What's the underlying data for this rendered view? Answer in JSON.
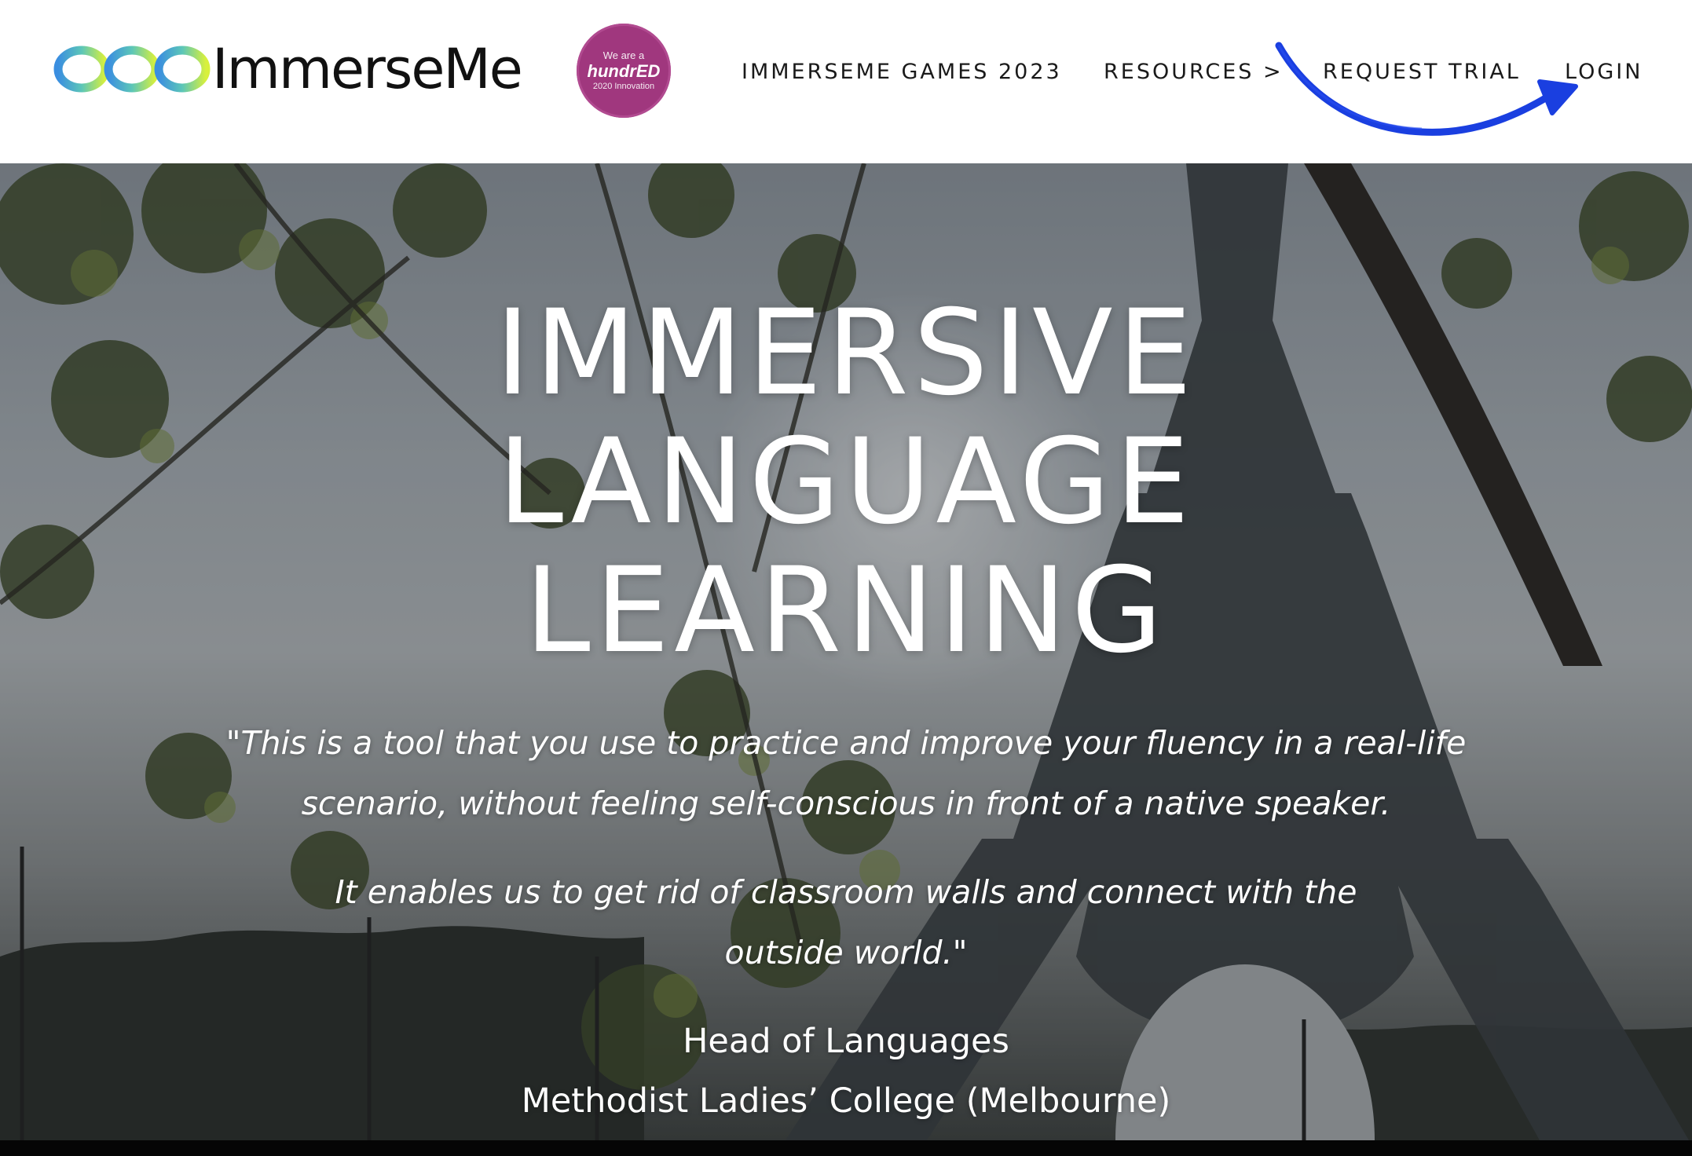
{
  "header": {
    "logo_text": "ImmerseMe",
    "badge": {
      "top": "We are a",
      "brand": "hundrED",
      "sub": "2020 Innovation"
    },
    "nav": [
      {
        "label": "IMMERSEME GAMES 2023"
      },
      {
        "label": "RESOURCES >"
      },
      {
        "label": "REQUEST TRIAL"
      },
      {
        "label": "LOGIN"
      }
    ]
  },
  "hero": {
    "title_lines": [
      "IMMERSIVE",
      "LANGUAGE",
      "LEARNING"
    ],
    "quote_1": "\"This is a tool that you use to practice and improve your fluency in a real-life scenario, without feeling self-conscious in front of a native speaker.",
    "quote_2": "It enables us to get rid of classroom walls and connect with the outside world.\"",
    "attribution_role": "Head of Languages",
    "attribution_org": "Methodist Ladies’ College (Melbourne)"
  },
  "colors": {
    "header_bg": "#ffffff",
    "nav_text": "#1a1a1a",
    "badge_bg": "#a0377e",
    "logo_gradient_start": "#3a8ee0",
    "logo_gradient_end": "#d8f03c",
    "annotation_arrow": "#1a3fe0",
    "hero_text": "#ffffff"
  },
  "icons": {
    "logo_mark": "infinity-loops-icon",
    "annotation": "hand-drawn-arrow-icon"
  }
}
